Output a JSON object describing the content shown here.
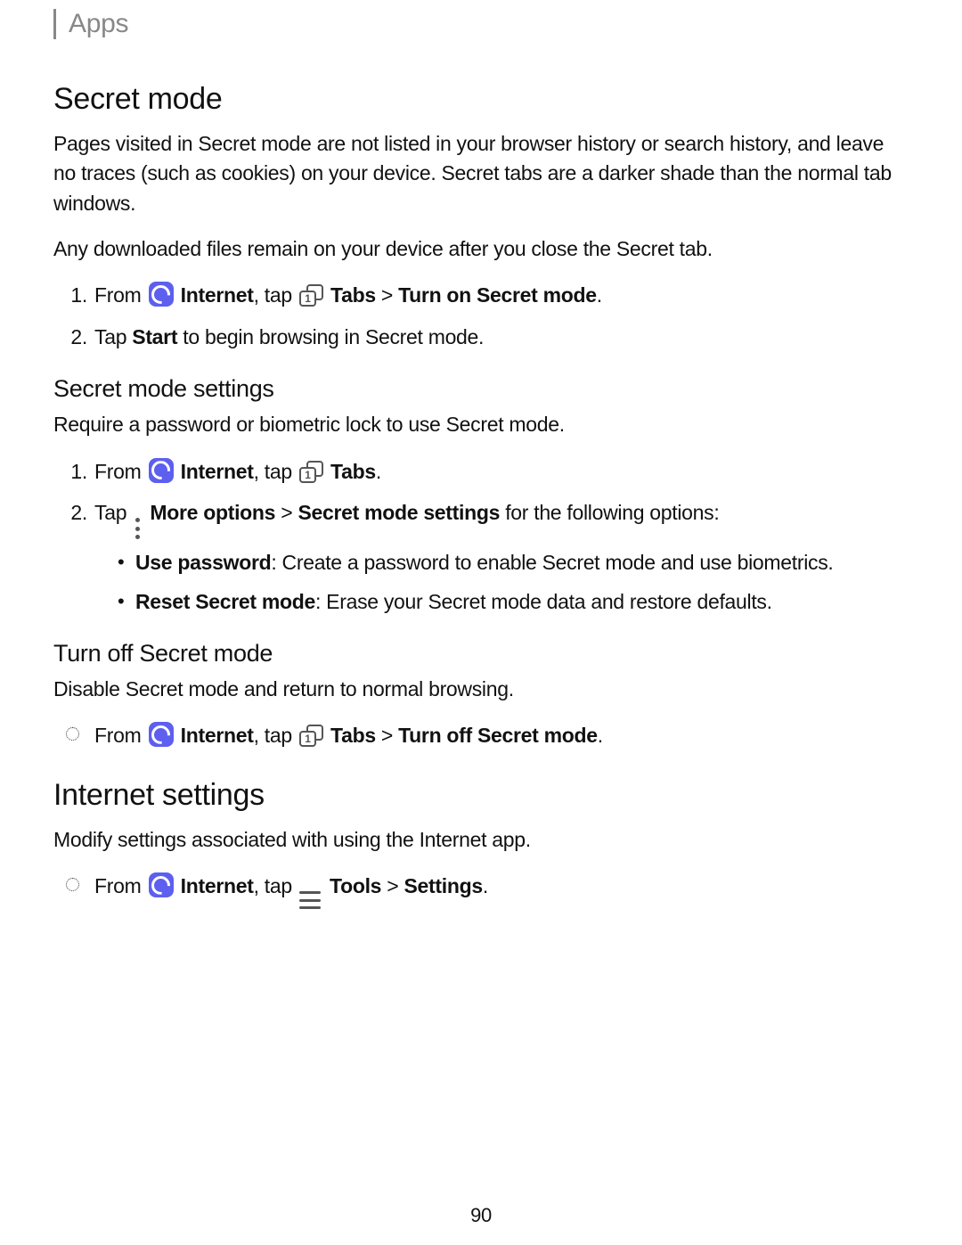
{
  "header": {
    "section": "Apps"
  },
  "page_number": "90",
  "secret_mode": {
    "heading": "Secret mode",
    "para1": "Pages visited in Secret mode are not listed in your browser history or search history, and leave no traces (such as cookies) on your device. Secret tabs are a darker shade than the normal tab windows.",
    "para2": "Any downloaded files remain on your device after you close the Secret tab.",
    "step1": {
      "prefix": "From ",
      "internet": "Internet",
      "mid": ", tap ",
      "tabs": "Tabs",
      "sep": " > ",
      "action": "Turn on Secret mode",
      "end": "."
    },
    "step2": {
      "prefix": "Tap ",
      "start": "Start",
      "rest": " to begin browsing in Secret mode."
    }
  },
  "settings": {
    "heading": "Secret mode settings",
    "intro": "Require a password or biometric lock to use Secret mode.",
    "step1": {
      "prefix": "From ",
      "internet": "Internet",
      "mid": ", tap ",
      "tabs": "Tabs",
      "end": "."
    },
    "step2": {
      "prefix": "Tap ",
      "more": "More options",
      "sep": " > ",
      "sms": "Secret mode settings",
      "rest": " for the following options:"
    },
    "opt1": {
      "label": "Use password",
      "text": ": Create a password to enable Secret mode and use biometrics."
    },
    "opt2": {
      "label": "Reset Secret mode",
      "text": ": Erase your Secret mode data and restore defaults."
    }
  },
  "turnoff": {
    "heading": "Turn off Secret mode",
    "intro": "Disable Secret mode and return to normal browsing.",
    "step": {
      "prefix": "From ",
      "internet": "Internet",
      "mid": ", tap ",
      "tabs": "Tabs",
      "sep": " > ",
      "action": "Turn off Secret mode",
      "end": "."
    }
  },
  "internet_settings": {
    "heading": "Internet settings",
    "intro": "Modify settings associated with using the Internet app.",
    "step": {
      "prefix": "From ",
      "internet": "Internet",
      "mid": ", tap ",
      "tools": "Tools",
      "sep": " > ",
      "action": "Settings",
      "end": "."
    }
  }
}
